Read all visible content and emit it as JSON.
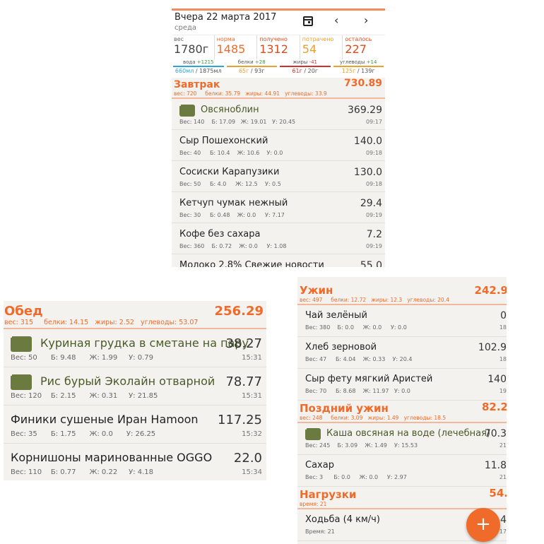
{
  "header": {
    "date": "Вчера 22 марта 2017",
    "weekday": "среда",
    "prev_label": "‹",
    "next_label": "›"
  },
  "stats": [
    {
      "label": "вес",
      "value": "1780г",
      "color": "#444444"
    },
    {
      "label": "норма",
      "value": "1485",
      "color": "#f06a2a"
    },
    {
      "label": "получено",
      "value": "1312",
      "color": "#e04a1a"
    },
    {
      "label": "потрачено",
      "value": "54",
      "color": "#e8a030"
    },
    {
      "label": "осталось",
      "value": "227",
      "color": "#e04a1a"
    }
  ],
  "macros": [
    {
      "label": "вода",
      "delta": "+1215",
      "amount_a": "660мл",
      "amount_b": " / 1875мл",
      "color": "#2aa6d8",
      "delta_color": "#3a9a3a"
    },
    {
      "label": "белки",
      "delta": "+28",
      "amount_a": "65г",
      "amount_b": " / 93г",
      "color": "#e8a030",
      "delta_color": "#3a9a3a"
    },
    {
      "label": "жиры",
      "delta": "-41",
      "amount_a": "61г",
      "amount_b": " / 20г",
      "color": "#d03030",
      "delta_color": "#d03030"
    },
    {
      "label": "углеводы",
      "delta": "+14",
      "amount_a": "125г",
      "amount_b": " / 139г",
      "color": "#e8a030",
      "delta_color": "#3a9a3a"
    }
  ],
  "breakfast": {
    "title": "Завтрак",
    "total": "730.89",
    "sub": "вес: 720     белки: 35.79   жиры: 44.91   углеводы: 33.9",
    "items": [
      {
        "name": "Овсяноблин",
        "kcal": "369.29",
        "meta": "Вес: 140    Б: 17.09   Ж: 19.01   У: 20.45",
        "time": "09:17",
        "recipe": true
      },
      {
        "name": "Сыр Пошехонский",
        "kcal": "140.0",
        "meta": "Вес: 40     Б: 10.4    Ж: 10.6    У: 0.0",
        "time": "09:18",
        "recipe": false
      },
      {
        "name": "Сосиски Карапузики",
        "kcal": "130.0",
        "meta": "Вес: 50     Б: 4.0     Ж: 12.5    У: 0.5",
        "time": "09:18",
        "recipe": false
      },
      {
        "name": "Кетчуп чумак нежный",
        "kcal": "29.4",
        "meta": "Вес: 30     Б: 0.48    Ж: 0.0     У: 7.17",
        "time": "09:19",
        "recipe": false
      },
      {
        "name": "Кофе без сахара",
        "kcal": "7.2",
        "meta": "Вес: 360    Б: 0.72    Ж: 0.0     У: 1.08",
        "time": "09:19",
        "recipe": false
      },
      {
        "name": "Молоко 2,8% Свежие новости",
        "kcal": "55.0",
        "meta": "",
        "time": "",
        "recipe": false
      }
    ]
  },
  "lunch": {
    "title": "Обед",
    "total": "256.29",
    "sub": "вес: 315     белки: 14.15   жиры: 2.52   углеводы: 53.07",
    "items": [
      {
        "name": "Куриная грудка в сметане на пару",
        "kcal": "38.27",
        "meta": "Вес: 50      Б: 9.48      Ж: 1.99     У: 0.79",
        "time": "15:31",
        "recipe": true
      },
      {
        "name": "Рис бурый Эколайн отварной",
        "kcal": "78.77",
        "meta": "Вес: 120    Б: 2.15      Ж: 0.31     У: 21.85",
        "time": "15:31",
        "recipe": true
      },
      {
        "name": "Финики сушеные Иран Hamoon",
        "kcal": "117.25",
        "meta": "Вес: 35      Б: 1.75      Ж: 0.0      У: 26.25",
        "time": "15:32",
        "recipe": false
      },
      {
        "name": "Корнишоны маринованные OGGO",
        "kcal": "22.0",
        "meta": "Вес: 110    Б: 0.77      Ж: 0.22     У: 4.18",
        "time": "15:34",
        "recipe": false
      }
    ]
  },
  "dinner": {
    "title": "Ужин",
    "total": "242.9",
    "sub": "вес: 497     белки: 12.72   жиры: 12.3   углеводы: 20.4",
    "items": [
      {
        "name": "Чай зелёный",
        "kcal": "0",
        "meta": "Вес: 380    Б: 0.0     Ж: 0.0     У: 0.0",
        "time": "18",
        "recipe": false
      },
      {
        "name": "Хлеб зерновой",
        "kcal": "102.9",
        "meta": "Вес: 47     Б: 4.04    Ж: 0.33    У: 20.4",
        "time": "18",
        "recipe": false
      },
      {
        "name": "Сыр фету мягкий Аристей",
        "kcal": "140",
        "meta": "Вес: 70     Б: 8.68    Ж: 11.97   У: 0.0",
        "time": "19",
        "recipe": false
      }
    ]
  },
  "late_dinner": {
    "title": "Поздний ужин",
    "total": "82.2",
    "sub": "вес: 248     белки: 3.09   жиры: 1.49   углеводы: 18.5",
    "items": [
      {
        "name": "Каша овсяная на воде (лечебная)",
        "kcal": "70.3",
        "meta": "Вес: 245    Б: 3.09    Ж: 1.49    У: 15.53",
        "time": "21",
        "recipe": true
      },
      {
        "name": "Сахар",
        "kcal": "11.8",
        "meta": "Вес: 3      Б: 0.0     Ж: 0.0     У: 2.97",
        "time": "21",
        "recipe": false
      }
    ]
  },
  "activity": {
    "title": "Нагрузки",
    "total": "54.",
    "sub": "время: 21",
    "items": [
      {
        "name": "Ходьба (4 км/ч)",
        "kcal": "4",
        "meta": "Время: 21",
        "time": "17",
        "recipe": false
      }
    ]
  },
  "fab_label": "+"
}
